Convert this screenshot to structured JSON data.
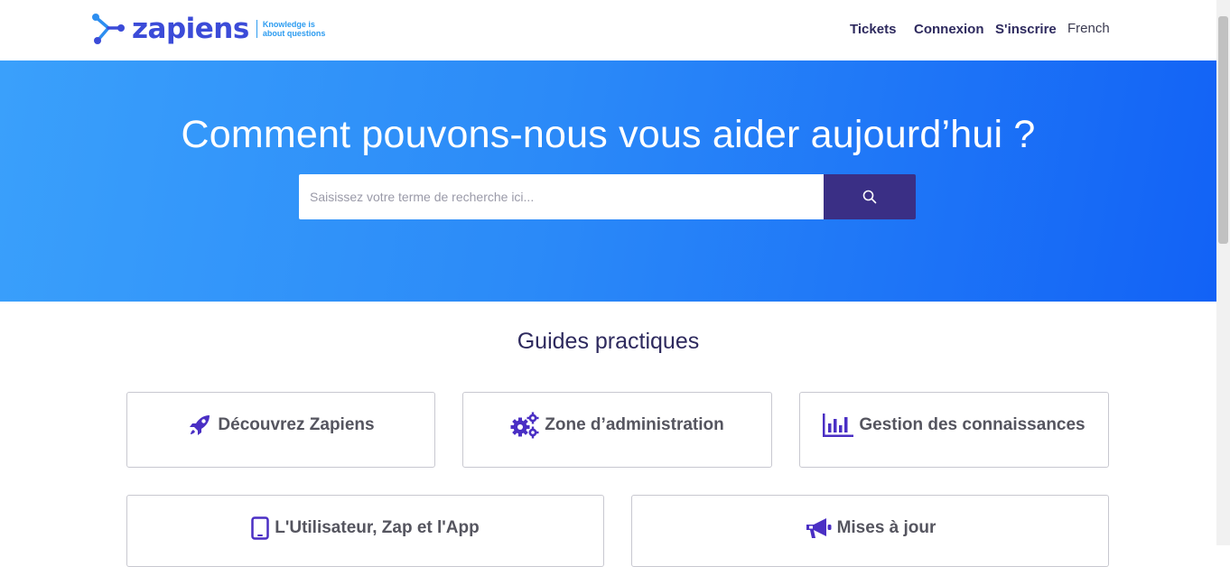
{
  "header": {
    "logo_text": "zapiens",
    "tagline_line1": "Knowledge is",
    "tagline_line2": "about questions",
    "nav": {
      "tickets": "Tickets",
      "login": "Connexion",
      "signup": "S'inscrire",
      "language": "French"
    }
  },
  "hero": {
    "title": "Comment pouvons-nous vous aider aujourd’hui ?",
    "search_placeholder": "Saisissez votre terme de recherche ici..."
  },
  "guides": {
    "title": "Guides practiques",
    "cards": [
      {
        "label": "Découvrez Zapiens",
        "icon": "rocket-icon"
      },
      {
        "label": "Zone d’administration",
        "icon": "gears-icon"
      },
      {
        "label": "Gestion des connaissances",
        "icon": "bar-chart-icon"
      },
      {
        "label": "L'Utilisateur, Zap et l'App",
        "icon": "tablet-icon"
      },
      {
        "label": "Mises à jour",
        "icon": "megaphone-icon"
      }
    ]
  },
  "colors": {
    "accent": "#4a2fc4",
    "brand_dark": "#3a2f85",
    "hero_start": "#3aa0fb",
    "hero_end": "#1262f6"
  }
}
